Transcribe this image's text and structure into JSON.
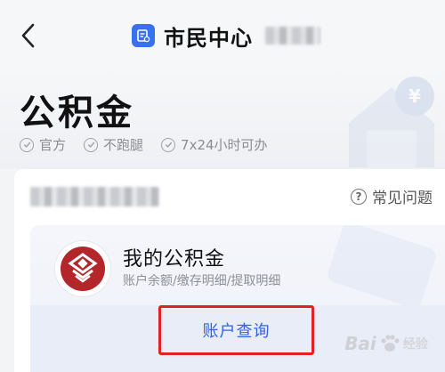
{
  "nav": {
    "title": "市民中心",
    "back_icon": "chevron-left-icon",
    "app_icon": "doc-badge-icon",
    "accent": "#3a6ff0"
  },
  "hero": {
    "title": "公积金",
    "tags": [
      {
        "label": "官方",
        "icon": "check-circle-icon"
      },
      {
        "label": "不跑腿",
        "icon": "check-circle-icon"
      },
      {
        "label": "7x24小时可办",
        "icon": "check-circle-icon"
      }
    ]
  },
  "card": {
    "faq_label": "常见问题",
    "faq_icon": "question-circle-icon",
    "product": {
      "name": "我的公积金",
      "desc": "账户余额/缴存明细/提取明细",
      "logo_color": "#b3262a"
    },
    "action_label": "账户查询",
    "action_color": "#2f63e6",
    "highlight_color": "#e02222"
  },
  "watermark": {
    "text": "Bai",
    "suffix": "经验"
  }
}
